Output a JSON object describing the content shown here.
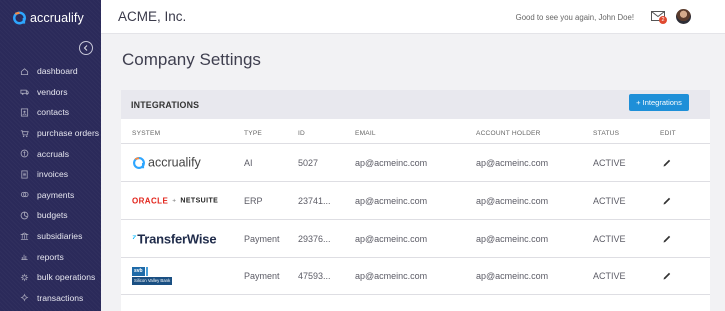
{
  "brand": {
    "name": "accrualify",
    "color": "#1e8fd8"
  },
  "sidebar": {
    "collapse_icon": "chevron-left-icon",
    "items": [
      {
        "label": "dashboard",
        "icon": "dashboard-icon"
      },
      {
        "label": "vendors",
        "icon": "vendors-icon"
      },
      {
        "label": "contacts",
        "icon": "contacts-icon"
      },
      {
        "label": "purchase orders",
        "icon": "purchase-orders-icon"
      },
      {
        "label": "accruals",
        "icon": "accruals-icon"
      },
      {
        "label": "invoices",
        "icon": "invoices-icon"
      },
      {
        "label": "payments",
        "icon": "payments-icon"
      },
      {
        "label": "budgets",
        "icon": "budgets-icon"
      },
      {
        "label": "subsidiaries",
        "icon": "subsidiaries-icon"
      },
      {
        "label": "reports",
        "icon": "reports-icon"
      },
      {
        "label": "bulk operations",
        "icon": "bulk-operations-icon"
      },
      {
        "label": "transactions",
        "icon": "transactions-icon"
      }
    ]
  },
  "header": {
    "company": "ACME, Inc.",
    "greeting": "Good to see you again, John Doe!",
    "notification_count": "2"
  },
  "main": {
    "title": "Company Settings",
    "integrations": {
      "title": "INTEGRATIONS",
      "add_button": "+ Integrations",
      "columns": [
        "SYSTEM",
        "TYPE",
        "ID",
        "EMAIL",
        "ACCOUNT HOLDER",
        "STATUS",
        "EDIT"
      ],
      "rows": [
        {
          "logo": "accrualify",
          "logo_text": "accrualify",
          "type": "AI",
          "id": "5027",
          "email": "ap@acmeinc.com",
          "holder": "ap@acmeinc.com",
          "status": "ACTIVE"
        },
        {
          "logo": "oracle-netsuite",
          "logo_text": "ORACLE + NETSUITE",
          "logo_oracle": "ORACLE",
          "logo_plus": "+",
          "logo_netsuite": "NETSUITE",
          "type": "ERP",
          "id": "23741...",
          "email": "ap@acmeinc.com",
          "holder": "ap@acmeinc.com",
          "status": "ACTIVE"
        },
        {
          "logo": "transferwise",
          "logo_text": "TransferWise",
          "type": "Payment",
          "id": "29376...",
          "email": "ap@acmeinc.com",
          "holder": "ap@acmeinc.com",
          "status": "ACTIVE"
        },
        {
          "logo": "silicon-valley-bank",
          "logo_text": "Silicon Valley Bank",
          "logo_mark": "svb",
          "type": "Payment",
          "id": "47593...",
          "email": "ap@acmeinc.com",
          "holder": "ap@acmeinc.com",
          "status": "ACTIVE"
        }
      ]
    }
  }
}
